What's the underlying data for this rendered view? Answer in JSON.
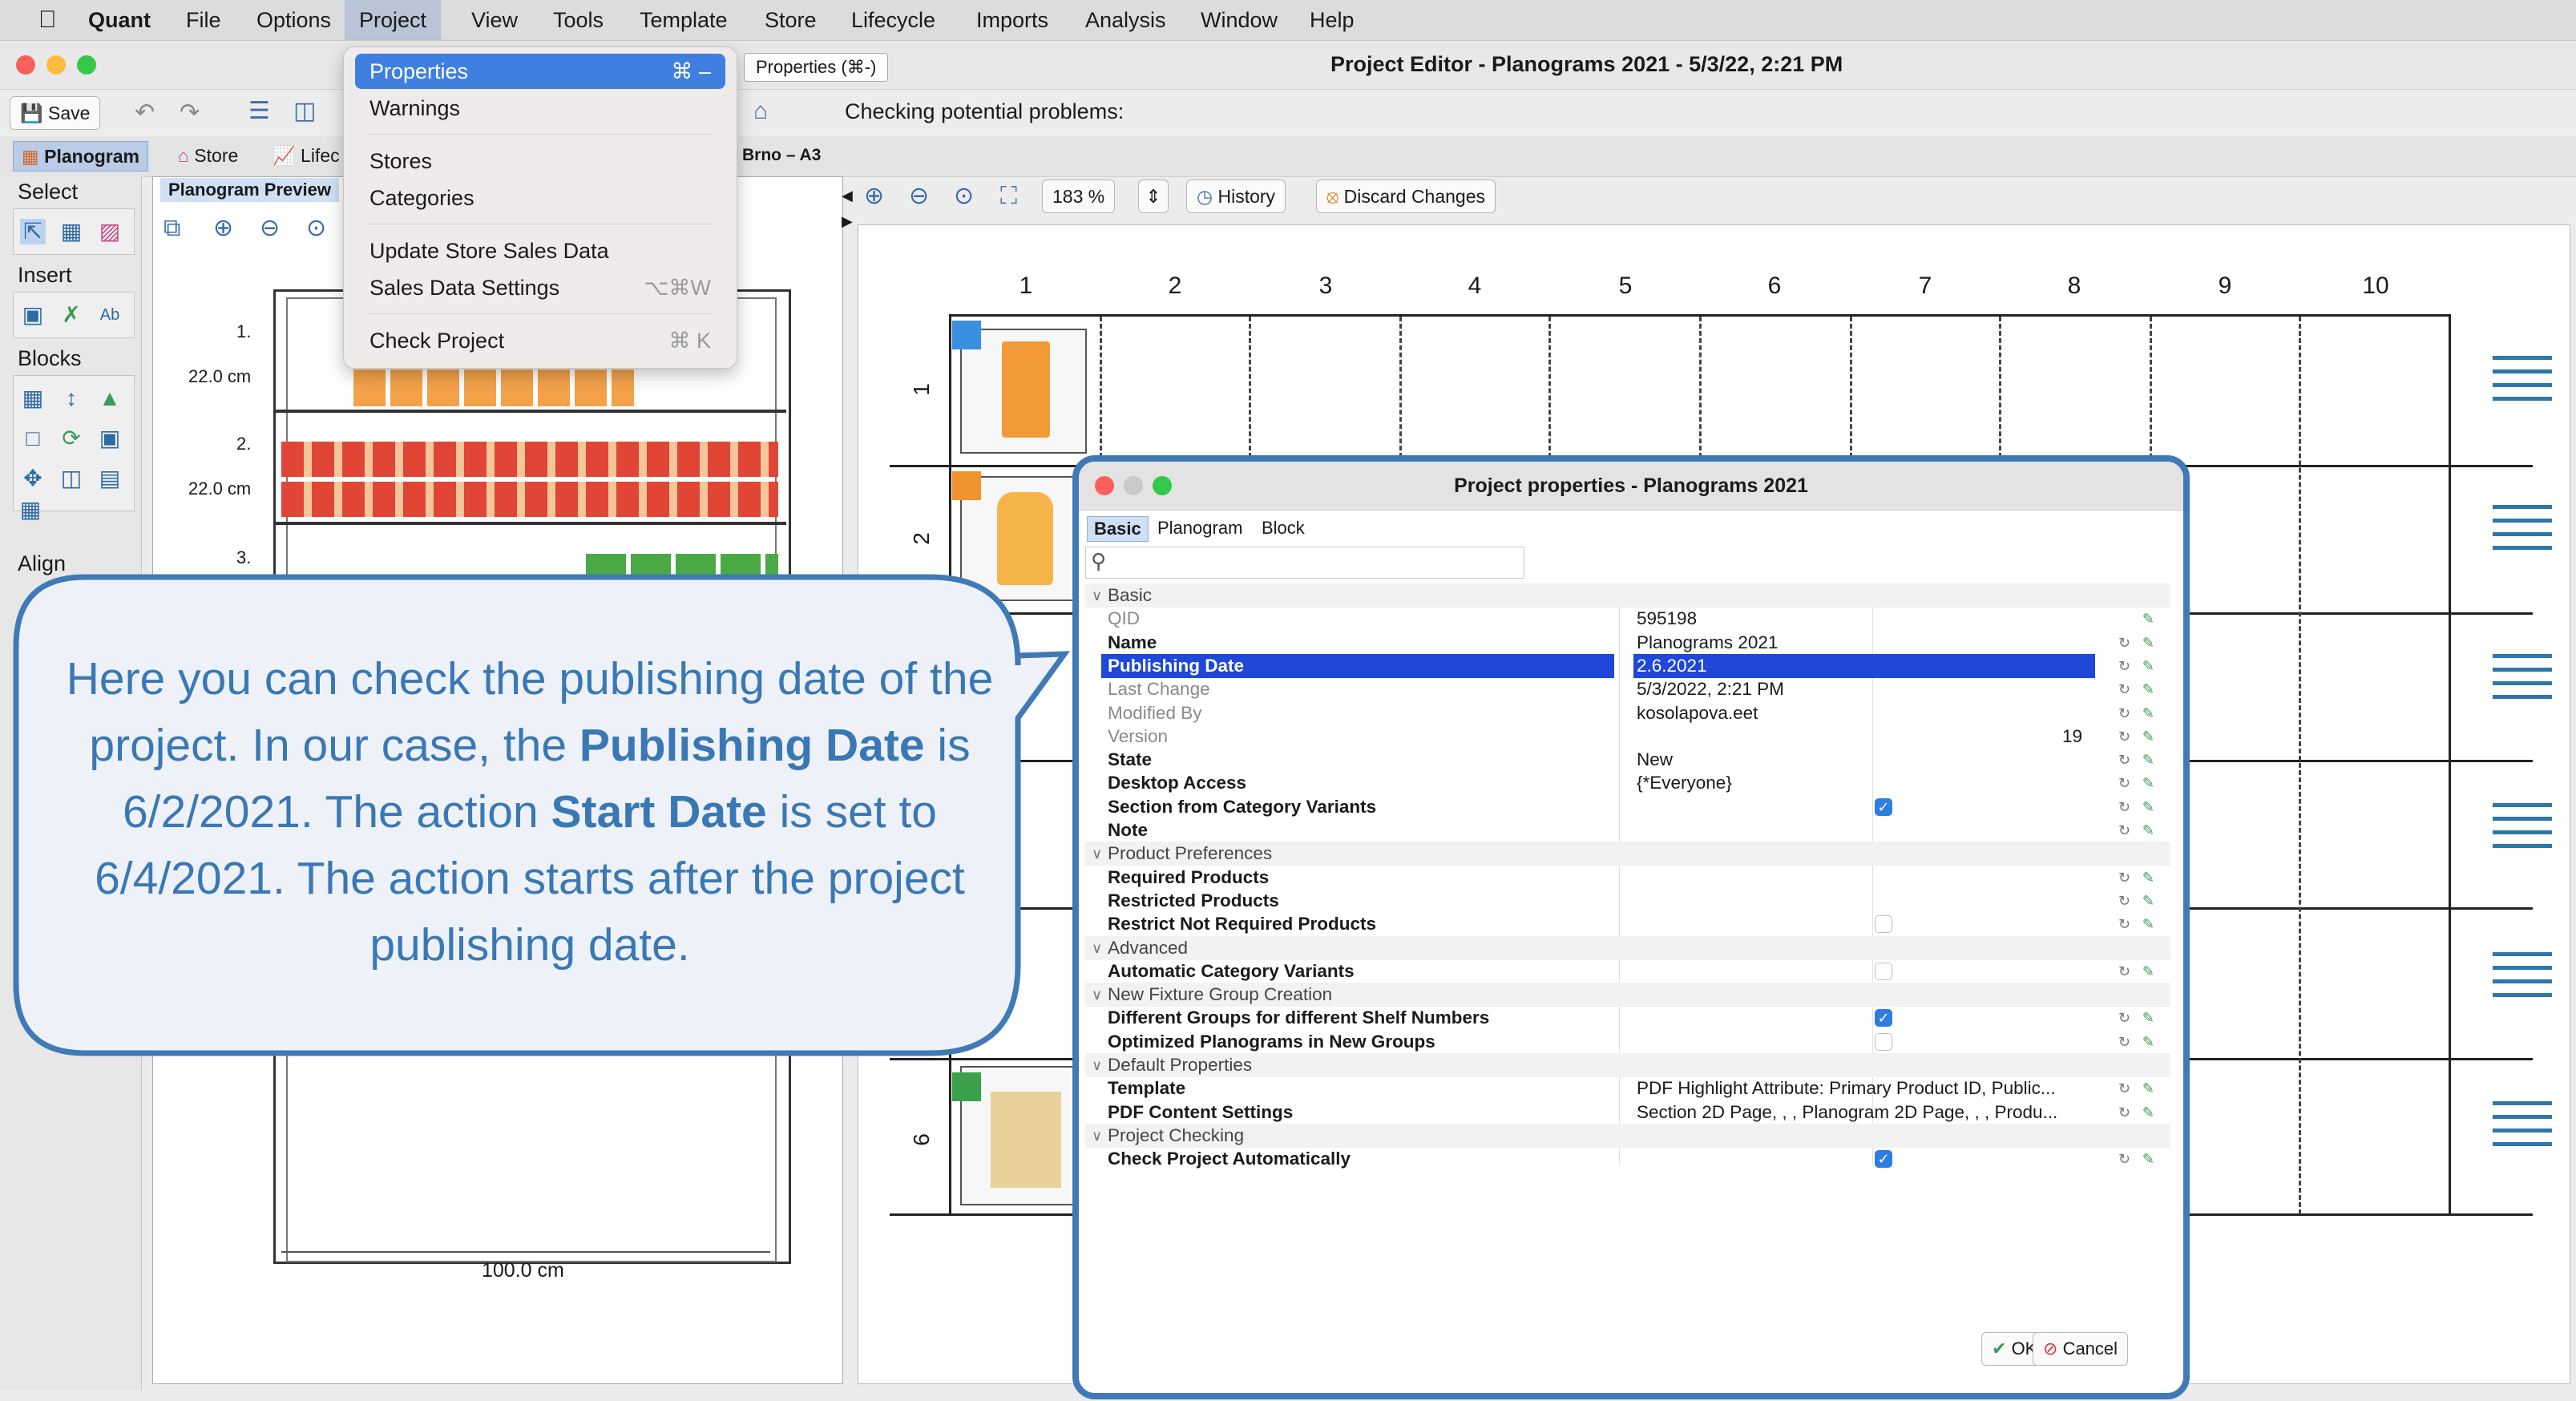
{
  "menubar": {
    "apple": "",
    "app_name": "Quant",
    "items": [
      "File",
      "Options",
      "Project",
      "View",
      "Tools",
      "Template",
      "Store",
      "Lifecycle",
      "Imports",
      "Analysis",
      "Window",
      "Help"
    ]
  },
  "window": {
    "title": "Project Editor - Planograms 2021 - 5/3/22, 2:21 PM",
    "properties_chip": "Properties  (⌘-)"
  },
  "toolbar": {
    "save_label": "Save",
    "status_text": "Checking potential problems:",
    "history_label": "History",
    "discard_label": "Discard Changes",
    "zoom_value": "183 %"
  },
  "tabs": {
    "planogram": "Planogram",
    "store": "Store",
    "lifecycle": "Lifec",
    "store_path": "Brno – A3"
  },
  "palette": {
    "select": "Select",
    "insert": "Insert",
    "blocks": "Blocks",
    "align": "Align"
  },
  "preview": {
    "tab_label": "Planogram Preview",
    "shelf_labels": [
      "1.",
      "2.",
      "3."
    ],
    "heights": [
      "22.0 cm",
      "22.0 cm"
    ],
    "width_label": "100.0 cm"
  },
  "canvas": {
    "columns": [
      "1",
      "2",
      "3",
      "4",
      "5",
      "6",
      "7",
      "8",
      "9",
      "10"
    ],
    "shelf_numbers": [
      "1",
      "2",
      "6"
    ],
    "colors": {
      "block_blue": "#3a8fe0",
      "block_orange": "#f0922e",
      "block_green": "#3aa04a"
    }
  },
  "project_menu": {
    "items": [
      {
        "label": "Properties",
        "shortcut": "⌘ –"
      },
      {
        "label": "Warnings",
        "shortcut": ""
      },
      {
        "label": "Stores",
        "shortcut": ""
      },
      {
        "label": "Categories",
        "shortcut": ""
      },
      {
        "label": "Update Store Sales Data",
        "shortcut": ""
      },
      {
        "label": "Sales Data Settings",
        "shortcut": "⌥⌘W"
      },
      {
        "label": "Check Project",
        "shortcut": "⌘ K"
      }
    ]
  },
  "callout": {
    "part1": "Here you can check the publishing date of the project. In our case, the ",
    "bold1": "Publishing Date",
    "part2": " is 6/2/2021. The action ",
    "bold2": "Start Date",
    "part3": " is set to 6/4/2021. The action starts after the project publishing date."
  },
  "dialog": {
    "title": "Project properties - Planograms 2021",
    "tabs": [
      "Basic",
      "Planogram",
      "Block"
    ],
    "ok_label": "OK",
    "cancel_label": "Cancel",
    "rows": [
      {
        "type": "cat",
        "name": "Basic"
      },
      {
        "type": "gray",
        "name": "QID",
        "value": "595198"
      },
      {
        "type": "bold",
        "name": "Name",
        "value": "Planograms 2021"
      },
      {
        "type": "sel",
        "name": "Publishing Date",
        "value": "2.6.2021"
      },
      {
        "type": "gray",
        "name": "Last Change",
        "value": "5/3/2022, 2:21 PM"
      },
      {
        "type": "gray",
        "name": "Modified By",
        "value": "kosolapova.eet"
      },
      {
        "type": "gray",
        "name": "Version",
        "value": "19",
        "align": "right"
      },
      {
        "type": "bold",
        "name": "State",
        "value": "New"
      },
      {
        "type": "bold",
        "name": "Desktop Access",
        "value": "{*Everyone}"
      },
      {
        "type": "bold",
        "name": "Section from Category Variants",
        "check": true
      },
      {
        "type": "bold",
        "name": "Note",
        "value": ""
      },
      {
        "type": "cat",
        "name": "Product Preferences"
      },
      {
        "type": "bold",
        "name": "Required Products",
        "value": ""
      },
      {
        "type": "bold",
        "name": "Restricted Products",
        "value": ""
      },
      {
        "type": "bold",
        "name": "Restrict Not Required Products",
        "check": false
      },
      {
        "type": "cat",
        "name": "Advanced"
      },
      {
        "type": "bold",
        "name": "Automatic Category Variants",
        "check": false
      },
      {
        "type": "cat",
        "name": "New Fixture Group Creation"
      },
      {
        "type": "bold",
        "name": "Different Groups for different Shelf Numbers",
        "check": true
      },
      {
        "type": "bold",
        "name": "Optimized Planograms in New Groups",
        "check": false
      },
      {
        "type": "cat",
        "name": "Default Properties"
      },
      {
        "type": "bold",
        "name": "Template",
        "value": "PDF Highlight Attribute: Primary Product ID, Public..."
      },
      {
        "type": "bold",
        "name": "PDF Content Settings",
        "value": "Section 2D Page, , , Planogram 2D Page, , , Produ..."
      },
      {
        "type": "cat",
        "name": "Project Checking"
      },
      {
        "type": "bold",
        "name": "Check Project Automatically",
        "check": true
      }
    ]
  }
}
